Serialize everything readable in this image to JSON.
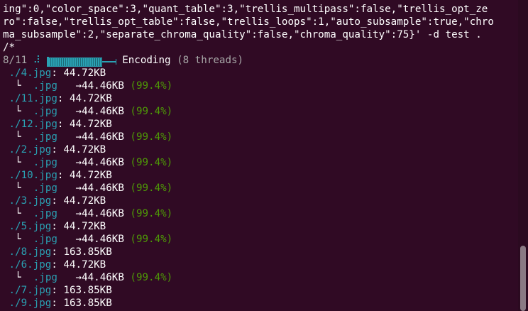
{
  "terminal": {
    "wrapped": [
      "ing\":0,\"color_space\":3,\"quant_table\":3,\"trellis_multipass\":false,\"trellis_opt_ze",
      "ro\":false,\"trellis_opt_table\":false,\"trellis_loops\":1,\"auto_subsample\":true,\"chro",
      "ma_subsample\":2,\"separate_chroma_quality\":false,\"chroma_quality\":75}' -d test .",
      "/*"
    ],
    "progress": {
      "count": "8/11",
      "spinner": "⠼",
      "status": "Encoding",
      "threads": "(8 threads)",
      "fraction": 0.8
    },
    "entries": [
      {
        "name": "./4.jpg",
        "size": "44.72KB",
        "output": ".jpg",
        "result": "44.46KB",
        "percent": "(99.4%)"
      },
      {
        "name": "./11.jpg",
        "size": "44.72KB",
        "output": ".jpg",
        "result": "44.46KB",
        "percent": "(99.4%)"
      },
      {
        "name": "./12.jpg",
        "size": "44.72KB",
        "output": ".jpg",
        "result": "44.46KB",
        "percent": "(99.4%)"
      },
      {
        "name": "./2.jpg",
        "size": "44.72KB",
        "output": ".jpg",
        "result": "44.46KB",
        "percent": "(99.4%)"
      },
      {
        "name": "./10.jpg",
        "size": "44.72KB",
        "output": ".jpg",
        "result": "44.46KB",
        "percent": "(99.4%)"
      },
      {
        "name": "./3.jpg",
        "size": "44.72KB",
        "output": ".jpg",
        "result": "44.46KB",
        "percent": "(99.4%)"
      },
      {
        "name": "./5.jpg",
        "size": "44.72KB",
        "output": ".jpg",
        "result": "44.46KB",
        "percent": "(99.4%)"
      },
      {
        "name": "./8.jpg",
        "size": "163.85KB"
      },
      {
        "name": "./6.jpg",
        "size": "44.72KB",
        "output": ".jpg",
        "result": "44.46KB",
        "percent": "(99.4%)"
      },
      {
        "name": "./7.jpg",
        "size": "163.85KB"
      },
      {
        "name": "./9.jpg",
        "size": "163.85KB"
      }
    ],
    "colors": {
      "background": "#300a24",
      "accent": "#2aa1b3",
      "success": "#4e9a06"
    }
  }
}
